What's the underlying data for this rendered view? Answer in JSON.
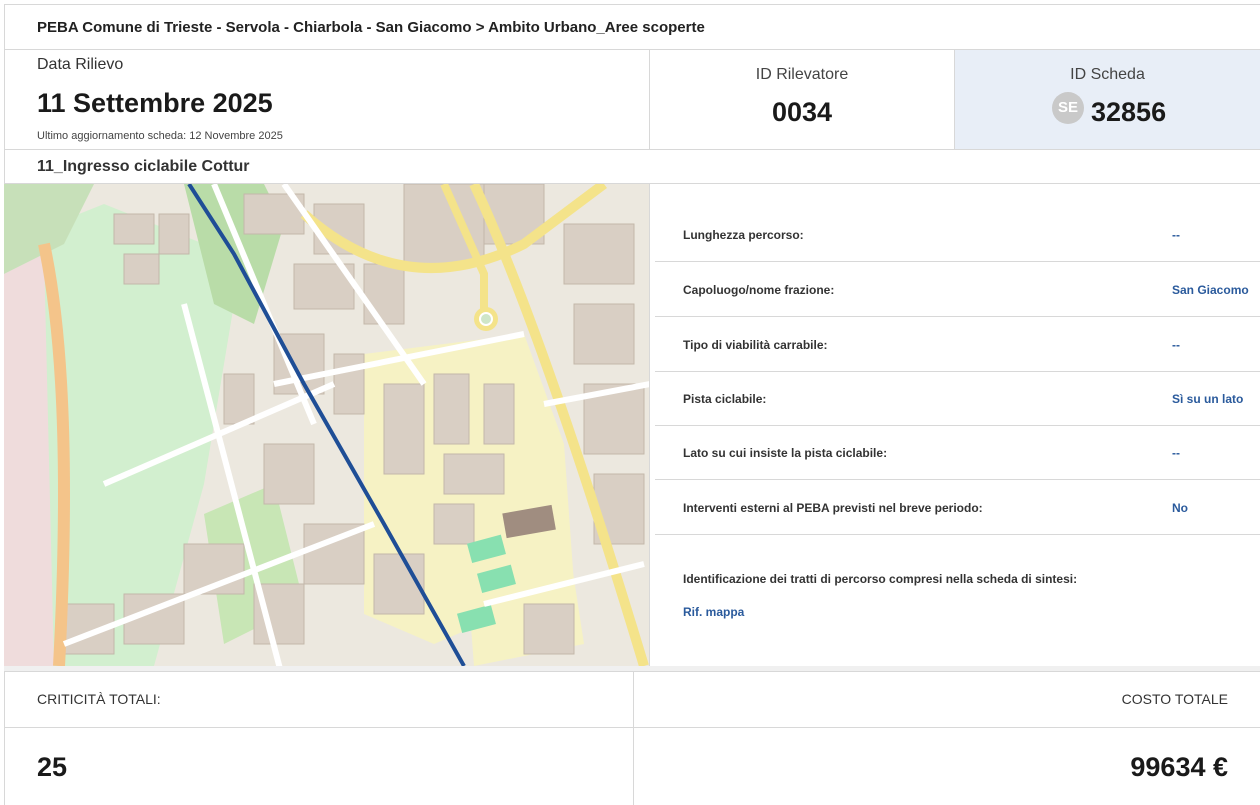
{
  "header": {
    "title": "PEBA Comune di Trieste - Servola - Chiarbola - San Giacomo > Ambito Urbano_Aree scoperte"
  },
  "survey": {
    "date_label": "Data Rilievo",
    "date_value": "11 Settembre 2025",
    "last_update": "Ultimo aggiornamento scheda: 12 Novembre 2025",
    "surveyor_label": "ID Rilevatore",
    "surveyor_value": "0034",
    "sheet_label": "ID Scheda",
    "sheet_badge": "SE",
    "sheet_value": "32856"
  },
  "section": {
    "title": "11_Ingresso ciclabile Cottur"
  },
  "details": [
    {
      "key": "Lunghezza percorso:",
      "value": "--"
    },
    {
      "key": "Capoluogo/nome frazione:",
      "value": "San Giacomo"
    },
    {
      "key": "Tipo di viabilità carrabile:",
      "value": "--"
    },
    {
      "key": "Pista ciclabile:",
      "value": "Sì su un lato"
    },
    {
      "key": "Lato su cui insiste la pista ciclabile:",
      "value": "--"
    },
    {
      "key": "Interventi esterni al PEBA previsti nel breve periodo:",
      "value": "No"
    }
  ],
  "identification": {
    "label": "Identificazione dei tratti di percorso compresi nella scheda di sintesi:",
    "link": "Rif. mappa"
  },
  "totals": {
    "criticita_label": "CRITICITÀ TOTALI:",
    "criticita_value": "25",
    "cost_label": "COSTO TOTALE",
    "cost_value": "99634 €"
  },
  "colors": {
    "accent_blue": "#2a5a9c",
    "sheet_bg": "#e8eef7",
    "route": "#1f4e96"
  }
}
